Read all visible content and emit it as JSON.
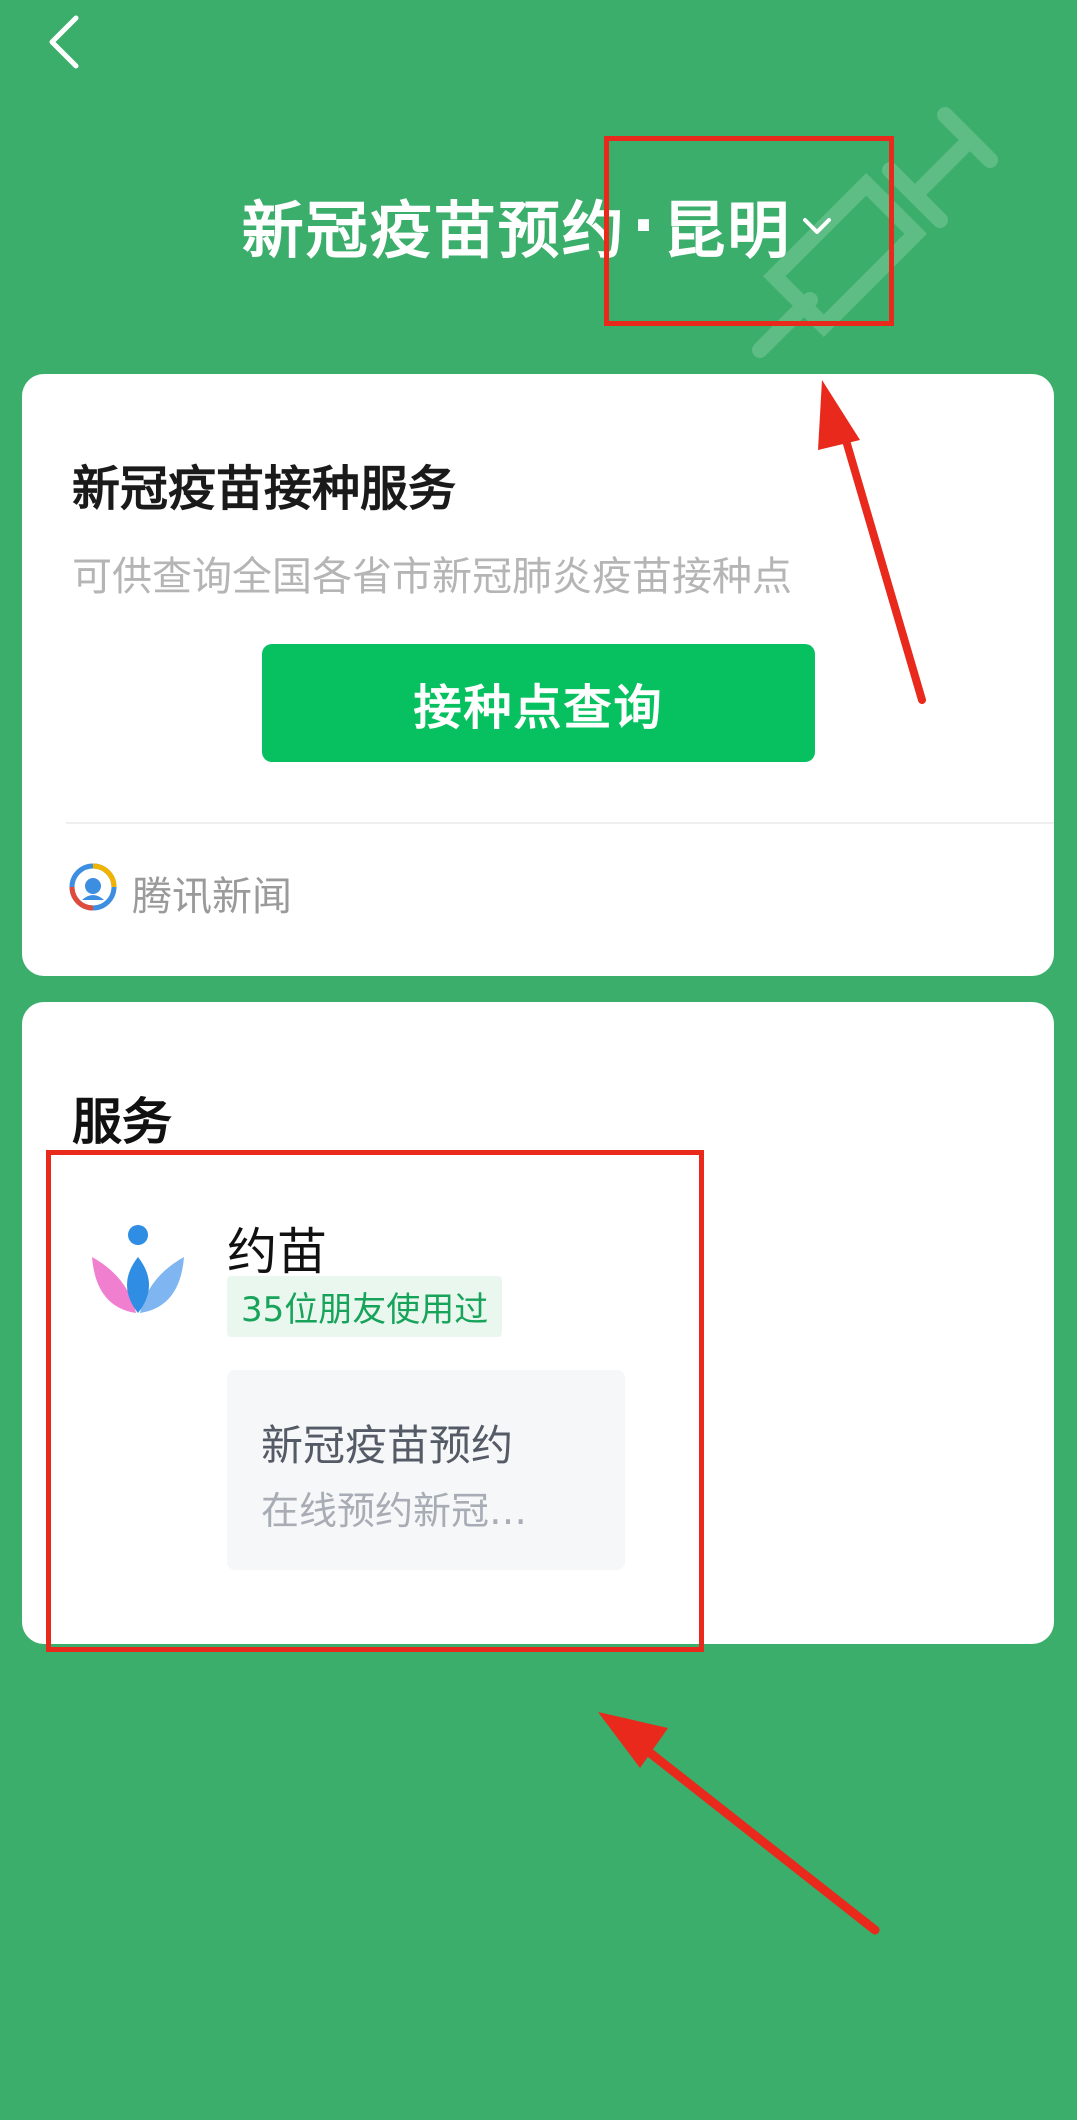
{
  "header": {
    "title": "新冠疫苗预约",
    "separator": "·",
    "city": "昆明",
    "back_icon": "chevron-left-icon",
    "city_dropdown_icon": "chevron-down-icon",
    "decoration_icon": "syringe-icon"
  },
  "vaccination_card": {
    "title": "新冠疫苗接种服务",
    "subtitle": "可供查询全国各省市新冠肺炎疫苗接种点",
    "button_label": "接种点查询",
    "source": {
      "icon": "tencent-news-logo",
      "name": "腾讯新闻"
    }
  },
  "services_card": {
    "heading": "服务",
    "item": {
      "icon": "yuemiao-app-icon",
      "name": "约苗",
      "friends_badge": "35位朋友使用过",
      "mini_program": {
        "title": "新冠疫苗预约",
        "description": "在线预约新冠…"
      }
    }
  },
  "colors": {
    "background": "#3aae6a",
    "primary_button": "#07c160",
    "badge_text": "#17a35a",
    "annotation_red": "#e8291c"
  }
}
